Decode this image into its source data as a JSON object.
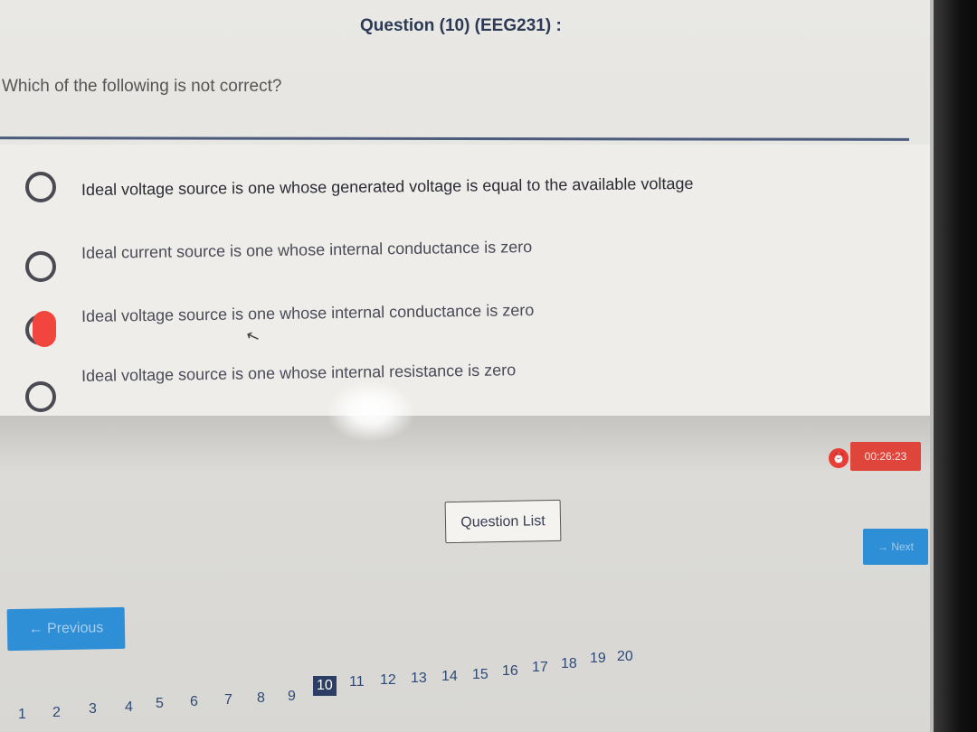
{
  "header": {
    "title": "Question (10) (EEG231) :"
  },
  "question": {
    "text": "Which of the following is not correct?"
  },
  "options": [
    {
      "label": "Ideal voltage source is one whose generated voltage is equal to the available voltage",
      "selected": false
    },
    {
      "label": "Ideal current source is one whose internal conductance is zero",
      "selected": false
    },
    {
      "label": "Ideal voltage source is one whose internal conductance is zero",
      "selected": true
    },
    {
      "label": "Ideal voltage source is one whose internal resistance is zero",
      "selected": false
    }
  ],
  "timer": {
    "value": "00:26:23",
    "icon": "alarm-clock-icon",
    "color": "#e0453c"
  },
  "nav": {
    "question_list_label": "Question List",
    "next_label": "Next",
    "previous_label": "Previous",
    "accent_color": "#2f8fd6"
  },
  "pager": {
    "pages": [
      "1",
      "2",
      "3",
      "4",
      "5",
      "6",
      "7",
      "8",
      "9",
      "10",
      "11",
      "12",
      "13",
      "14",
      "15",
      "16",
      "17",
      "18",
      "19",
      "20"
    ],
    "current": "10"
  }
}
